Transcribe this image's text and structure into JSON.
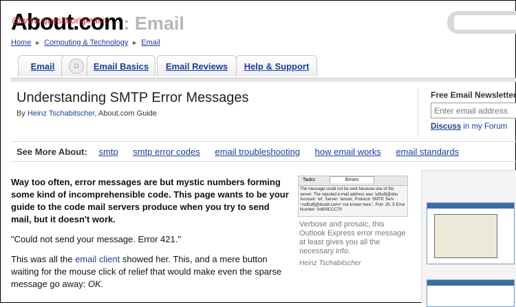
{
  "logo": {
    "site": "About.com",
    "section": ": Email",
    "watermark": "@www.quesitooriginal.it"
  },
  "breadcrumb": [
    "Home",
    "Computing & Technology",
    "Email"
  ],
  "tabs": [
    "Email",
    "Email Basics",
    "Email Reviews",
    "Help & Support"
  ],
  "article": {
    "title": "Understanding SMTP Error Messages",
    "byline_prefix": "By",
    "author": "Heinz Tschabitscher",
    "byline_suffix": ", About.com Guide"
  },
  "newsletter": {
    "heading": "Free Email Newsletter",
    "placeholder": "Enter email address",
    "discuss": "Discuss",
    "forum_text": " in my Forum"
  },
  "see_more": {
    "label": "See More About:",
    "links": [
      "smtp",
      "smtp error codes",
      "email troubleshooting",
      "how email works",
      "email standards"
    ]
  },
  "body": {
    "lead": "Way too often, error messages are but mystic numbers forming some kind of incomprehensible code. This page wants to be your guide to the code mail servers produce when you try to send mail, but it doesn't work.",
    "quote": "\"Could not send your message. Error 421.\"",
    "p3_before": "This was all the ",
    "p3_link": "email client",
    "p3_after": " showed her. This, and a mere button waiting for the mouse click of relief that would make even the sparse message go away: ",
    "p3_ok": "OK."
  },
  "figure": {
    "tabs": [
      "Tasks",
      "Errors"
    ],
    "message": "The message could not be sent because one of the server. The rejected e-mail address was 'sdfsdfj@dou Account: 'wt', Server: 'larose', Protocol: SMTP, Serv '<sdfsdfj@doubt.com>' not known here.', Port: 25, S Error Number: 0x800CCC79",
    "caption": "Verbose and prosaic, this Outlook Express error message at least gives you all the necessary info.",
    "credit": "Heinz Tschabitscher"
  }
}
